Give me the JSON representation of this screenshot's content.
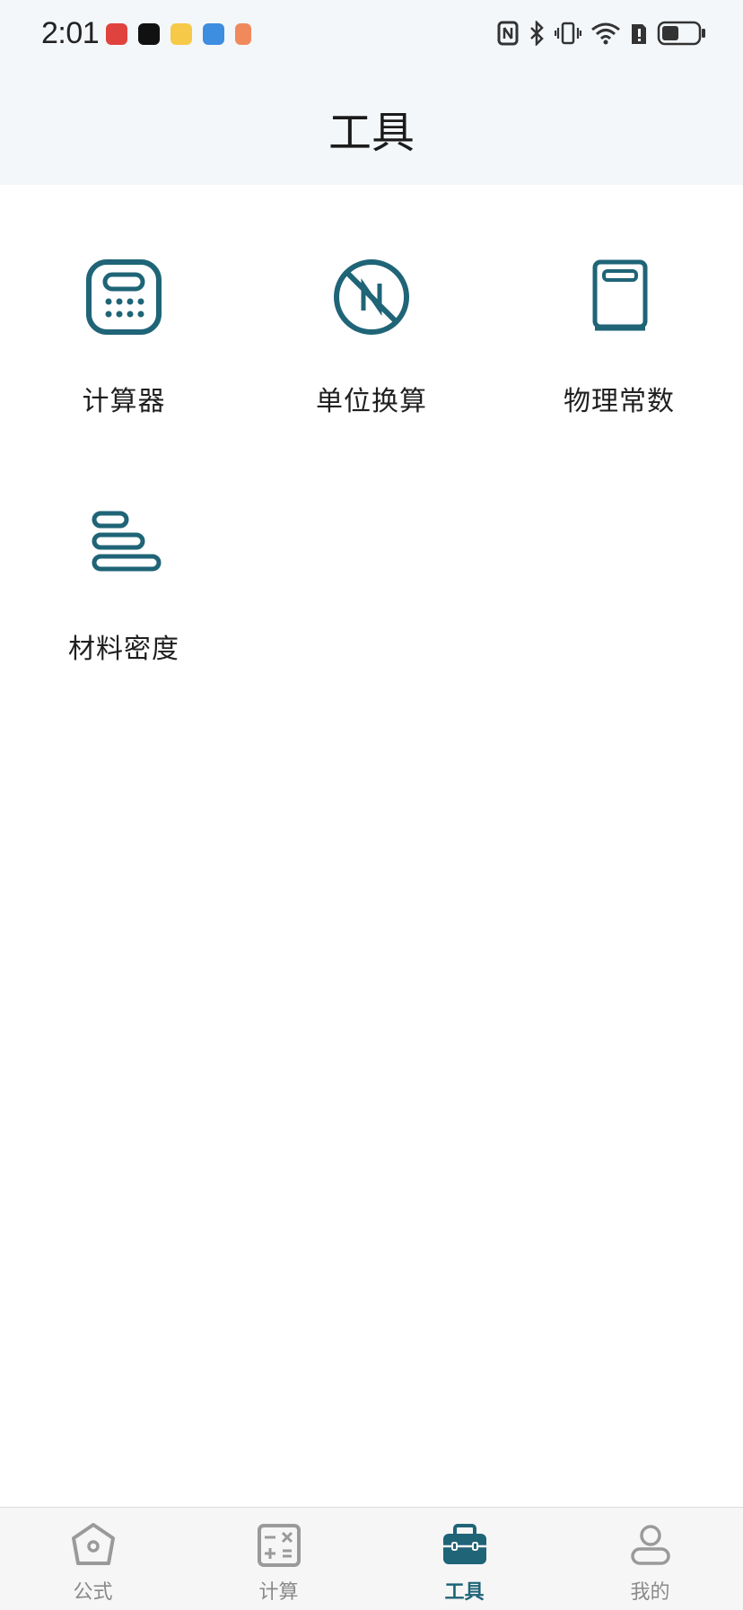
{
  "status_bar": {
    "time": "2:01",
    "notification_icons": [
      "huawei-store-icon",
      "video-app-icon",
      "weibo-icon",
      "weather-icon",
      "reader-icon"
    ],
    "system_icons": [
      "nfc-icon",
      "bluetooth-icon",
      "vibrate-icon",
      "wifi-icon",
      "sim-alert-icon",
      "battery-icon"
    ]
  },
  "header": {
    "title": "工具"
  },
  "tools": [
    {
      "label": "计算器",
      "icon": "calculator-icon"
    },
    {
      "label": "单位换算",
      "icon": "unit-convert-icon"
    },
    {
      "label": "物理常数",
      "icon": "book-icon"
    },
    {
      "label": "材料密度",
      "icon": "density-bars-icon"
    }
  ],
  "tabbar": {
    "tabs": [
      {
        "label": "公式",
        "icon": "formula-icon",
        "active": false
      },
      {
        "label": "计算",
        "icon": "calculate-icon",
        "active": false
      },
      {
        "label": "工具",
        "icon": "toolbox-icon",
        "active": true
      },
      {
        "label": "我的",
        "icon": "profile-icon",
        "active": false
      }
    ]
  },
  "colors": {
    "accent": "#1f6477",
    "inactive": "#8a8a8a",
    "header_bg": "#f4f7fa"
  }
}
